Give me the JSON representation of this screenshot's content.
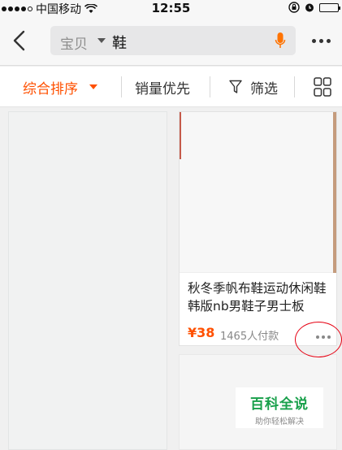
{
  "status_bar": {
    "carrier": "中国移动",
    "time": "12:55"
  },
  "search": {
    "scope": "宝贝",
    "query": "鞋"
  },
  "sort_bar": {
    "general": "综合排序",
    "sales": "销量优先",
    "filter": "筛选"
  },
  "products": [
    {
      "title": "秋冬季帆布鞋运动休闲鞋韩版nb男鞋子男士板",
      "price": "¥38",
      "sold": "1465人付款"
    }
  ],
  "watermark": {
    "title": "百科全说",
    "subtitle": "助你轻松解决"
  },
  "colors": {
    "accent": "#ff5000",
    "annotation": "#e60012",
    "watermark": "#19a04b"
  }
}
